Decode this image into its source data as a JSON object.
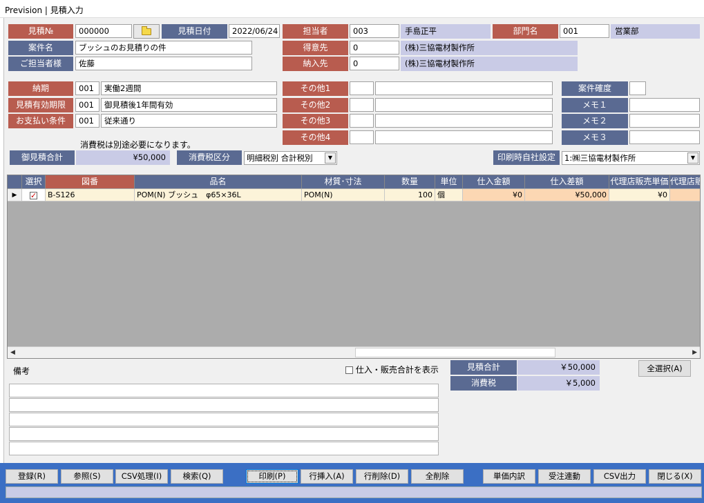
{
  "window": {
    "title": "Prevision | 見積入力"
  },
  "header": {
    "estimate_no_label": "見積№",
    "estimate_no": "000000",
    "estimate_date_label": "見積日付",
    "estimate_date": "2022/06/24",
    "staff_label": "担当者",
    "staff_code": "003",
    "staff_name": "手島正平",
    "dept_label": "部門名",
    "dept_code": "001",
    "dept_name": "営業部",
    "subject_label": "案件名",
    "subject": "ブッシュのお見積りの件",
    "customer_label": "得意先",
    "customer_code": "0",
    "customer_name": "(株)三協電材製作所",
    "contact_label": "ご担当者様",
    "contact": "佐藤",
    "delivery_label": "納入先",
    "delivery_code": "0",
    "delivery_name": "(株)三協電材製作所"
  },
  "terms": {
    "due_label": "納期",
    "due_code": "001",
    "due_text": "実働2週間",
    "validity_label": "見積有効期限",
    "validity_code": "001",
    "validity_text": "御見積後1年間有効",
    "payment_label": "お支払い条件",
    "payment_code": "001",
    "payment_text": "従来通り",
    "tax_note": "消費税は別途必要になります。",
    "other1_label": "その他1",
    "other2_label": "その他2",
    "other3_label": "その他3",
    "other4_label": "その他4",
    "certainty_label": "案件確度",
    "memo1_label": "メモ１",
    "memo2_label": "メモ２",
    "memo3_label": "メモ３"
  },
  "summary": {
    "total_label": "御見積合計",
    "total_value": "¥50,000",
    "tax_type_label": "消費税区分",
    "tax_type_value": "明細税別 合計税別",
    "print_company_label": "印刷時自社設定",
    "print_company_value": "1:㈱三協電材製作所"
  },
  "grid": {
    "columns": [
      "選択",
      "図番",
      "品名",
      "材質･寸法",
      "数量",
      "単位",
      "仕入金額",
      "仕入差額",
      "代理店販売単価",
      "代理店販"
    ],
    "rows": [
      {
        "drawing_no": "B-S126",
        "name": "POM(N) ブッシュ　φ65×36L",
        "material": "POM(N)",
        "qty": "100",
        "unit": "個",
        "cost": "¥0",
        "diff": "¥50,000",
        "agent_price": "¥0",
        "agent_more": ""
      }
    ]
  },
  "footer": {
    "remarks_label": "備考",
    "show_totals_label": "仕入・販売合計を表示",
    "est_total_label": "見積合計",
    "est_total_value": "￥50,000",
    "tax_label": "消費税",
    "tax_value": "￥5,000",
    "select_all_label": "全選択(A)"
  },
  "buttons": {
    "register": "登録(R)",
    "reference": "参照(S)",
    "csv_process": "CSV処理(I)",
    "search": "検索(Q)",
    "print": "印刷(P)",
    "insert_row": "行挿入(A)",
    "delete_row": "行削除(D)",
    "delete_all": "全削除",
    "unit_price_detail": "単価内訳",
    "order_link": "受注連動",
    "csv_output": "CSV出力",
    "close": "閉じる(X)"
  },
  "colors": {
    "label_red": "#b85c4f",
    "label_navy": "#5a6a92",
    "value_lavender": "#c9cbe6",
    "bottom_blue": "#3b6fc4"
  }
}
